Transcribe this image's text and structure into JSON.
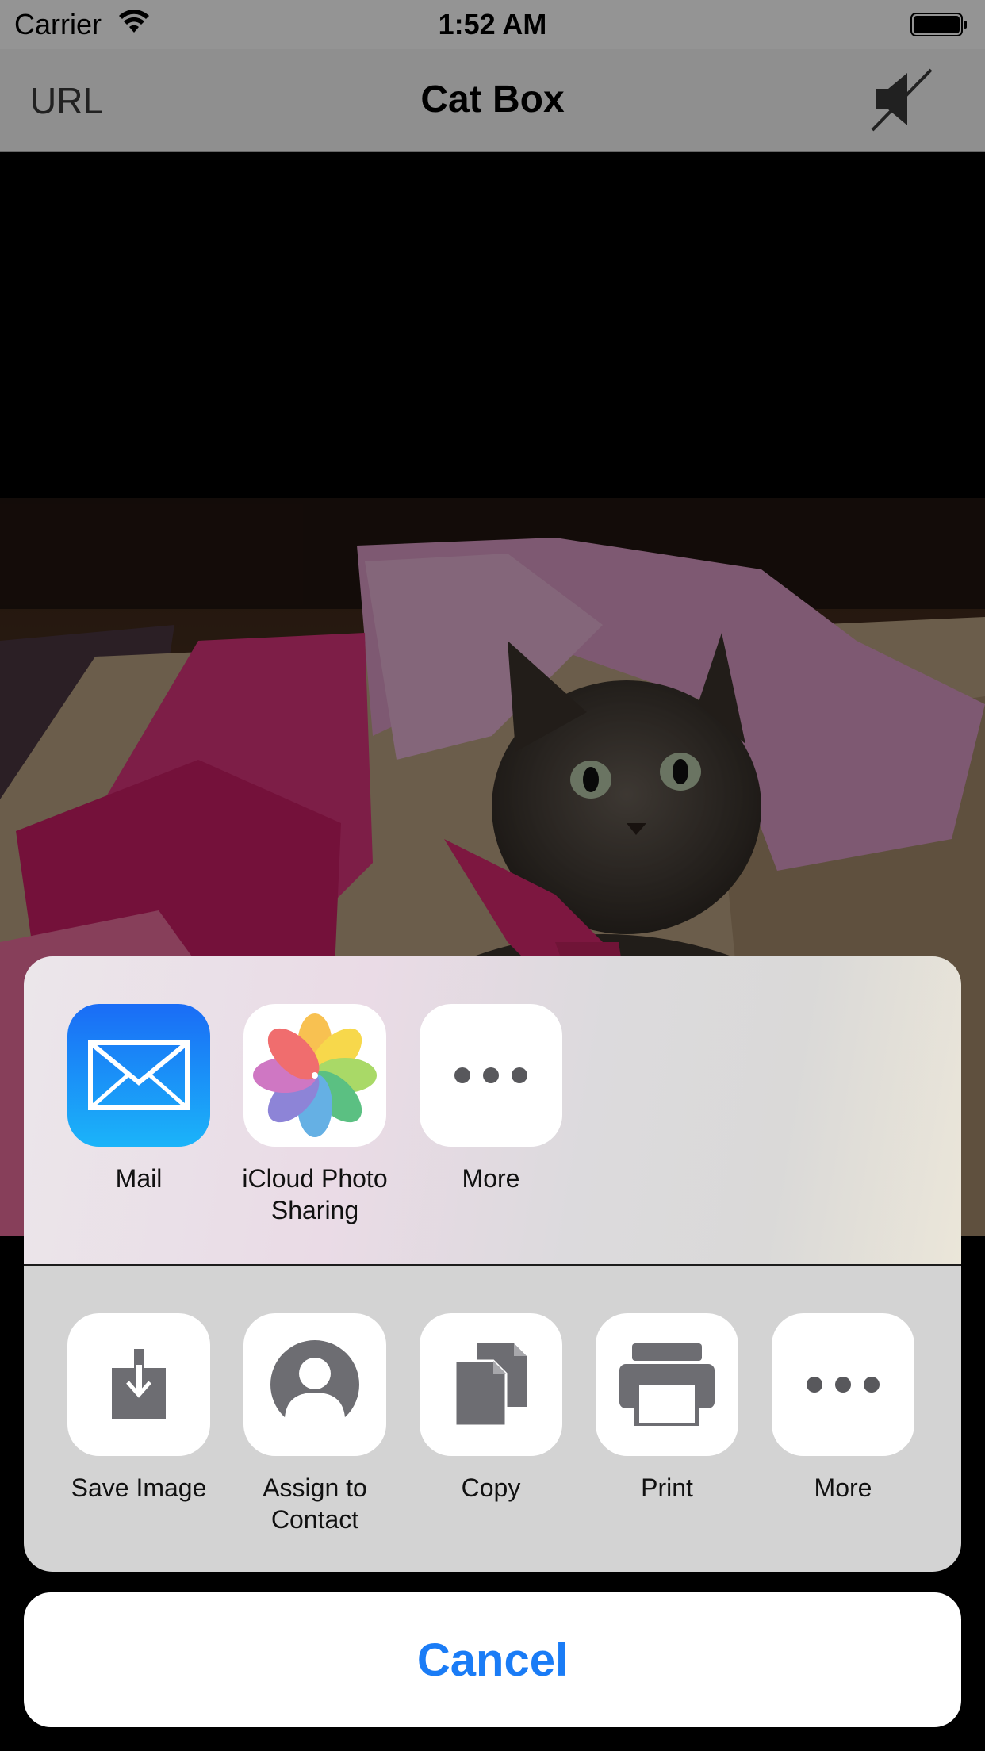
{
  "status_bar": {
    "carrier": "Carrier",
    "time": "1:52 AM",
    "wifi_icon": "wifi-icon",
    "battery_icon": "battery-icon"
  },
  "nav_bar": {
    "left_button": "URL",
    "title": "Cat Box",
    "right_icon": "speaker-muted-icon"
  },
  "content": {
    "image_description_icon": "cat-in-box-photo"
  },
  "share_sheet": {
    "share_items": [
      {
        "label": "Mail",
        "icon": "mail-icon"
      },
      {
        "label": "iCloud Photo\nSharing",
        "icon": "photos-icon"
      },
      {
        "label": "More",
        "icon": "more-icon"
      }
    ],
    "action_items": [
      {
        "label": "Save Image",
        "icon": "save-image-icon"
      },
      {
        "label": "Assign to\nContact",
        "icon": "contact-icon"
      },
      {
        "label": "Copy",
        "icon": "copy-icon"
      },
      {
        "label": "Print",
        "icon": "print-icon"
      },
      {
        "label": "More",
        "icon": "more-icon"
      }
    ]
  },
  "cancel_label": "Cancel",
  "colors": {
    "accent": "#1a7cf6",
    "icon_gray": "#6d6d72"
  }
}
